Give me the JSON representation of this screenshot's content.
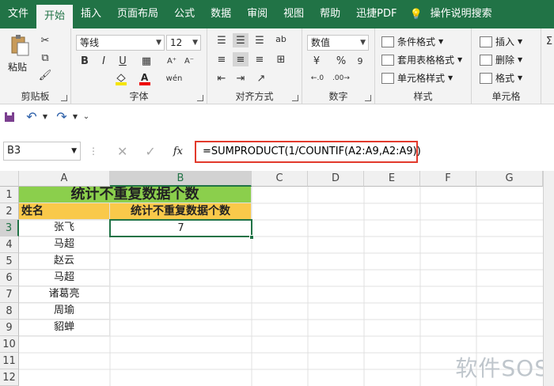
{
  "menu": {
    "tabs": [
      "文件",
      "开始",
      "插入",
      "页面布局",
      "公式",
      "数据",
      "审阅",
      "视图",
      "帮助",
      "迅捷PDF"
    ],
    "active": "开始",
    "tell_me": "操作说明搜索"
  },
  "ribbon": {
    "clipboard": {
      "label": "剪贴板",
      "paste": "粘贴"
    },
    "font": {
      "label": "字体",
      "name": "等线",
      "size": "12",
      "bold": "B",
      "italic": "I",
      "underline": "U",
      "phonetic": "wén"
    },
    "alignment": {
      "label": "对齐方式",
      "wrap": "ab"
    },
    "number": {
      "label": "数字",
      "format": "数值",
      "percent": "%",
      "comma": "9"
    },
    "styles": {
      "label": "样式",
      "conditional": "条件格式",
      "table": "套用表格格式",
      "cell": "单元格样式"
    },
    "cells": {
      "label": "单元格",
      "insert": "插入",
      "delete": "删除",
      "format": "格式"
    }
  },
  "formula_bar": {
    "name_box": "B3",
    "fx": "fx",
    "formula": "=SUMPRODUCT(1/COUNTIF(A2:A9,A2:A9))"
  },
  "sheet": {
    "columns": [
      "A",
      "B",
      "C",
      "D",
      "E",
      "F",
      "G"
    ],
    "rows": [
      "1",
      "2",
      "3",
      "4",
      "5",
      "6",
      "7",
      "8",
      "9",
      "10",
      "11",
      "12"
    ],
    "title": "统计不重复数据个数",
    "a2": "姓名",
    "b2": "统计不重复数据个数",
    "names": [
      "张飞",
      "马超",
      "赵云",
      "马超",
      "诸葛亮",
      "周瑜",
      "貂蝉"
    ],
    "b3": "7"
  },
  "watermark": "软件SOS",
  "colors": {
    "excel_green": "#217346",
    "title_fill": "#8bcf4c",
    "header_fill": "#f9c94a",
    "highlight_border": "#e23a2c"
  }
}
